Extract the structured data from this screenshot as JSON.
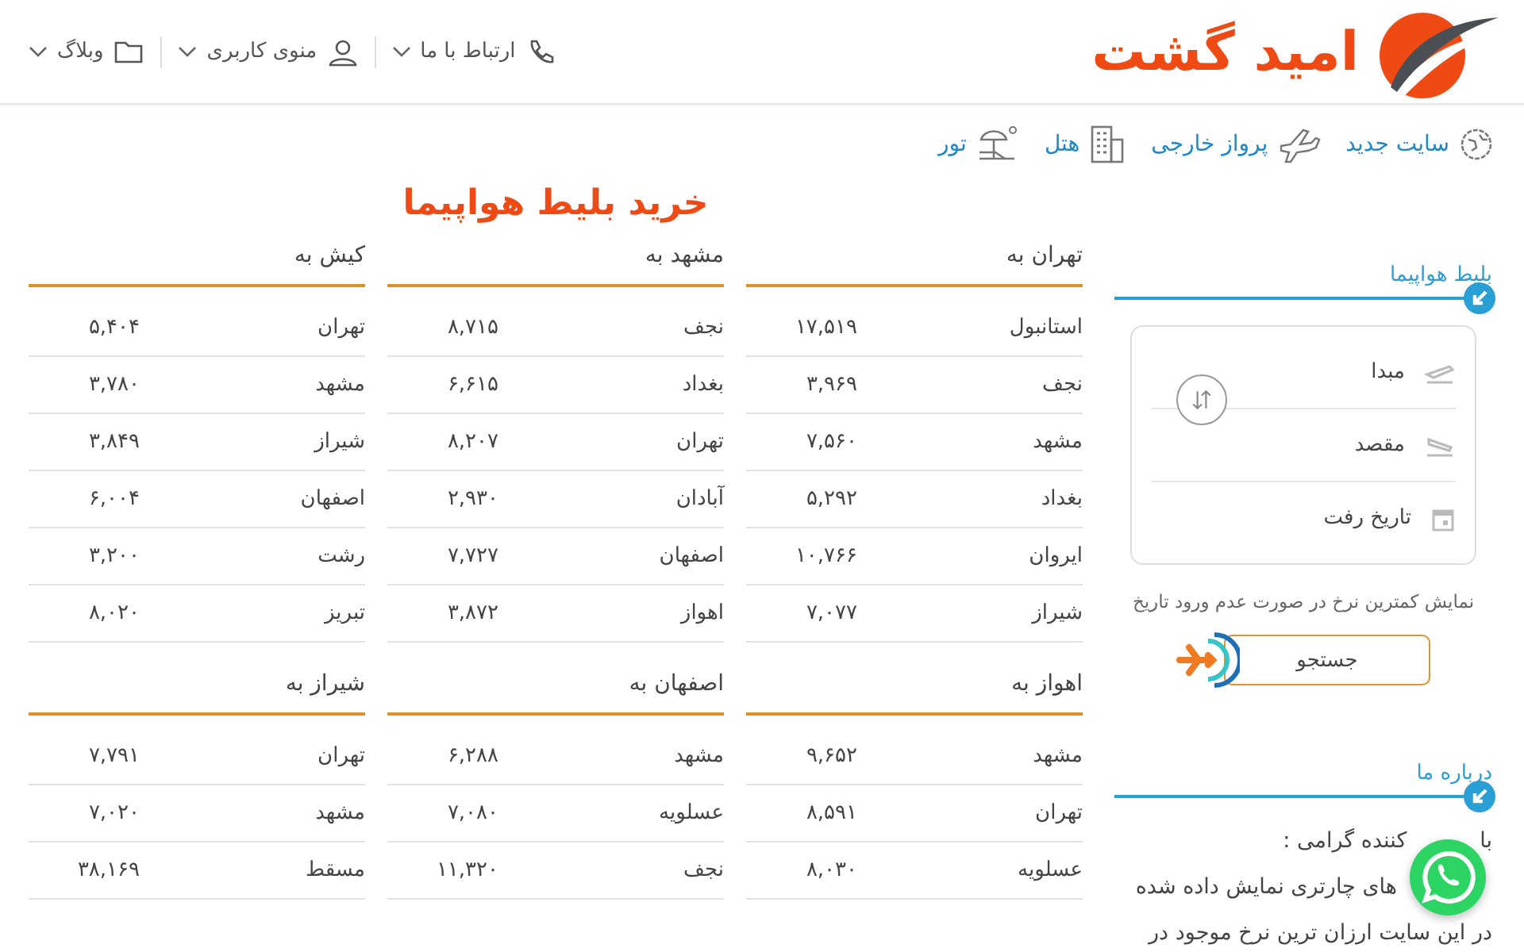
{
  "header": {
    "logo_text": "امید گشت",
    "menu": [
      {
        "label": "ارتباط با ما"
      },
      {
        "label": "منوی کاربری"
      },
      {
        "label": "وبلاگ"
      }
    ]
  },
  "nav": [
    {
      "label": "سایت جدید"
    },
    {
      "label": "پرواز خارجی"
    },
    {
      "label": "هتل"
    },
    {
      "label": "تور"
    }
  ],
  "page_title": "خرید بلیط هواپیما",
  "tables": [
    {
      "heading": "تهران به",
      "rows": [
        {
          "city": "استانبول",
          "price": "۱۷,۵۱۹"
        },
        {
          "city": "نجف",
          "price": "۳,۹۶۹"
        },
        {
          "city": "مشهد",
          "price": "۷,۵۶۰"
        },
        {
          "city": "بغداد",
          "price": "۵,۲۹۲"
        },
        {
          "city": "ایروان",
          "price": "۱۰,۷۶۶"
        },
        {
          "city": "شیراز",
          "price": "۷,۰۷۷"
        }
      ]
    },
    {
      "heading": "مشهد به",
      "rows": [
        {
          "city": "نجف",
          "price": "۸,۷۱۵"
        },
        {
          "city": "بغداد",
          "price": "۶,۶۱۵"
        },
        {
          "city": "تهران",
          "price": "۸,۲۰۷"
        },
        {
          "city": "آبادان",
          "price": "۲,۹۳۰"
        },
        {
          "city": "اصفهان",
          "price": "۷,۷۲۷"
        },
        {
          "city": "اهواز",
          "price": "۳,۸۷۲"
        }
      ]
    },
    {
      "heading": "کیش به",
      "rows": [
        {
          "city": "تهران",
          "price": "۵,۴۰۴"
        },
        {
          "city": "مشهد",
          "price": "۳,۷۸۰"
        },
        {
          "city": "شیراز",
          "price": "۳,۸۴۹"
        },
        {
          "city": "اصفهان",
          "price": "۶,۰۰۴"
        },
        {
          "city": "رشت",
          "price": "۳,۲۰۰"
        },
        {
          "city": "تبریز",
          "price": "۸,۰۲۰"
        }
      ]
    },
    {
      "heading": "اهواز به",
      "rows": [
        {
          "city": "مشهد",
          "price": "۹,۶۵۲"
        },
        {
          "city": "تهران",
          "price": "۸,۵۹۱"
        },
        {
          "city": "عسلویه",
          "price": "۸,۰۳۰"
        }
      ]
    },
    {
      "heading": "اصفهان به",
      "rows": [
        {
          "city": "مشهد",
          "price": "۶,۲۸۸"
        },
        {
          "city": "عسلویه",
          "price": "۷,۰۸۰"
        },
        {
          "city": "نجف",
          "price": "۱۱,۳۲۰"
        }
      ]
    },
    {
      "heading": "شیراز به",
      "rows": [
        {
          "city": "تهران",
          "price": "۷,۷۹۱"
        },
        {
          "city": "مشهد",
          "price": "۷,۰۲۰"
        },
        {
          "city": "مسقط",
          "price": "۳۸,۱۶۹"
        }
      ]
    }
  ],
  "search_panel": {
    "title": "بلیط هواپیما",
    "fields": [
      {
        "placeholder": "مبدا"
      },
      {
        "placeholder": "مقصد"
      },
      {
        "placeholder": "تاریخ رفت"
      }
    ],
    "note": "نمایش کمترین نرخ در صورت عدم ورود تاریخ",
    "button": "جستجو"
  },
  "about": {
    "title": "درباره ما",
    "lines": [
      [
        "با",
        "کننده گرامی :"
      ],
      [
        "های چارتری نمایش داده شده"
      ],
      [
        "در این سایت ارزان ترین نرخ موجود در"
      ]
    ]
  }
}
